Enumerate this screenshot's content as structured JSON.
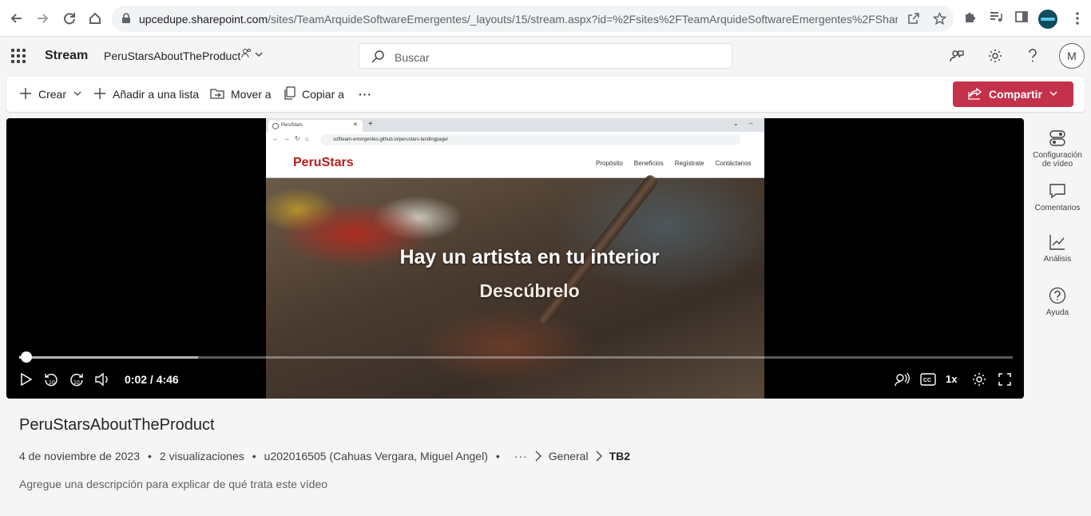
{
  "browser": {
    "url_host": "upcedupe.sharepoint.com",
    "url_rest": "/sites/TeamArquideSoftwareEmergentes/_layouts/15/stream.aspx?id=%2Fsites%2FTeamArquideSoftwareEmergentes%2FShare..."
  },
  "header": {
    "app_name": "Stream",
    "site_name": "PeruStarsAboutTheProduct",
    "search_placeholder": "Buscar",
    "avatar_initial": "M"
  },
  "commandbar": {
    "create": "Crear",
    "add_to_list": "Añadir a una lista",
    "move_to": "Mover a",
    "copy_to": "Copiar a",
    "more": "···",
    "share": "Compartir"
  },
  "video_frame": {
    "tab_title": "PeruStars",
    "address": "softteam-emergentes.github.io/perustars-landingpage/",
    "logo": "PeruStars",
    "nav_links": [
      "Propósito",
      "Beneficios",
      "Regístrate",
      "Contáctanos"
    ],
    "hero_title": "Hay un artista en tu interior",
    "hero_subtitle": "Descúbrelo"
  },
  "player": {
    "current_time": "0:02",
    "duration": "4:46",
    "time_display": "0:02 / 4:46",
    "played_fraction": 0.007,
    "buffered_fraction": 0.18,
    "speed": "1x",
    "skip_back_label": "10",
    "skip_fwd_label": "10"
  },
  "rail": {
    "video_settings": "Configuración de vídeo",
    "comments": "Comentarios",
    "analytics": "Análisis",
    "help": "Ayuda"
  },
  "video_info": {
    "title": "PeruStarsAboutTheProduct",
    "date": "4 de noviembre de 2023",
    "views": "2 visualizaciones",
    "owner": "u202016505 (Cahuas Vergara, Miguel Angel)",
    "more": "···",
    "crumb_general": "General",
    "crumb_current": "TB2",
    "description_placeholder": "Agregue una descripción para explicar de qué trata este vídeo"
  },
  "colors": {
    "share_button": "#c4314b",
    "logo_red": "#b71c1c"
  }
}
